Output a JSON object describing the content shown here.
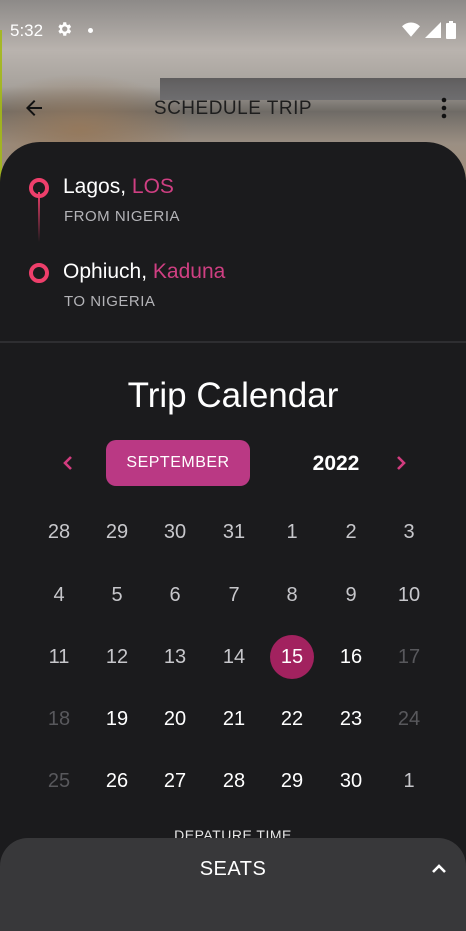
{
  "status_bar": {
    "time": "5:32",
    "icons": [
      "gear-icon",
      "notification-dot",
      "wifi-icon",
      "signal-icon",
      "battery-icon"
    ]
  },
  "app_bar": {
    "title": "SCHEDULE TRIP",
    "back_icon": "arrow-left-icon",
    "menu_icon": "more-vert-icon"
  },
  "route": {
    "from": {
      "city": "Lagos,",
      "code": "LOS",
      "subtitle": "FROM NIGERIA"
    },
    "to": {
      "city": "Ophiuch,",
      "code": "Kaduna",
      "subtitle": "TO NIGERIA"
    }
  },
  "calendar": {
    "title": "Trip Calendar",
    "month": "SEPTEMBER",
    "year": "2022",
    "selected_day": "15",
    "weeks": [
      [
        {
          "d": "28",
          "s": "muted"
        },
        {
          "d": "29",
          "s": "muted"
        },
        {
          "d": "30",
          "s": "muted"
        },
        {
          "d": "31",
          "s": "muted"
        },
        {
          "d": "1",
          "s": "muted"
        },
        {
          "d": "2",
          "s": "muted"
        },
        {
          "d": "3",
          "s": "muted"
        }
      ],
      [
        {
          "d": "4",
          "s": "muted"
        },
        {
          "d": "5",
          "s": "muted"
        },
        {
          "d": "6",
          "s": "muted"
        },
        {
          "d": "7",
          "s": "muted"
        },
        {
          "d": "8",
          "s": "muted"
        },
        {
          "d": "9",
          "s": "muted"
        },
        {
          "d": "10",
          "s": "muted"
        }
      ],
      [
        {
          "d": "11",
          "s": "muted"
        },
        {
          "d": "12",
          "s": "muted"
        },
        {
          "d": "13",
          "s": "muted"
        },
        {
          "d": "14",
          "s": "muted"
        },
        {
          "d": "15",
          "s": "selected"
        },
        {
          "d": "16",
          "s": "active"
        },
        {
          "d": "17",
          "s": "faded"
        }
      ],
      [
        {
          "d": "18",
          "s": "faded"
        },
        {
          "d": "19",
          "s": "active"
        },
        {
          "d": "20",
          "s": "active"
        },
        {
          "d": "21",
          "s": "active"
        },
        {
          "d": "22",
          "s": "active"
        },
        {
          "d": "23",
          "s": "active"
        },
        {
          "d": "24",
          "s": "faded"
        }
      ],
      [
        {
          "d": "25",
          "s": "faded"
        },
        {
          "d": "26",
          "s": "active"
        },
        {
          "d": "27",
          "s": "active"
        },
        {
          "d": "28",
          "s": "active"
        },
        {
          "d": "29",
          "s": "active"
        },
        {
          "d": "30",
          "s": "active"
        },
        {
          "d": "1",
          "s": "muted"
        }
      ]
    ]
  },
  "departure_label": "DEPATURE TIME",
  "bottom_sheet": {
    "label": "SEATS",
    "icon": "chevron-up-icon"
  },
  "colors": {
    "accent": "#ee3f6b",
    "brand": "#ba3984",
    "selected": "#a2225f",
    "code_text": "#cf3f82",
    "background": "#1b1b1d",
    "sheet": "#38383a"
  }
}
